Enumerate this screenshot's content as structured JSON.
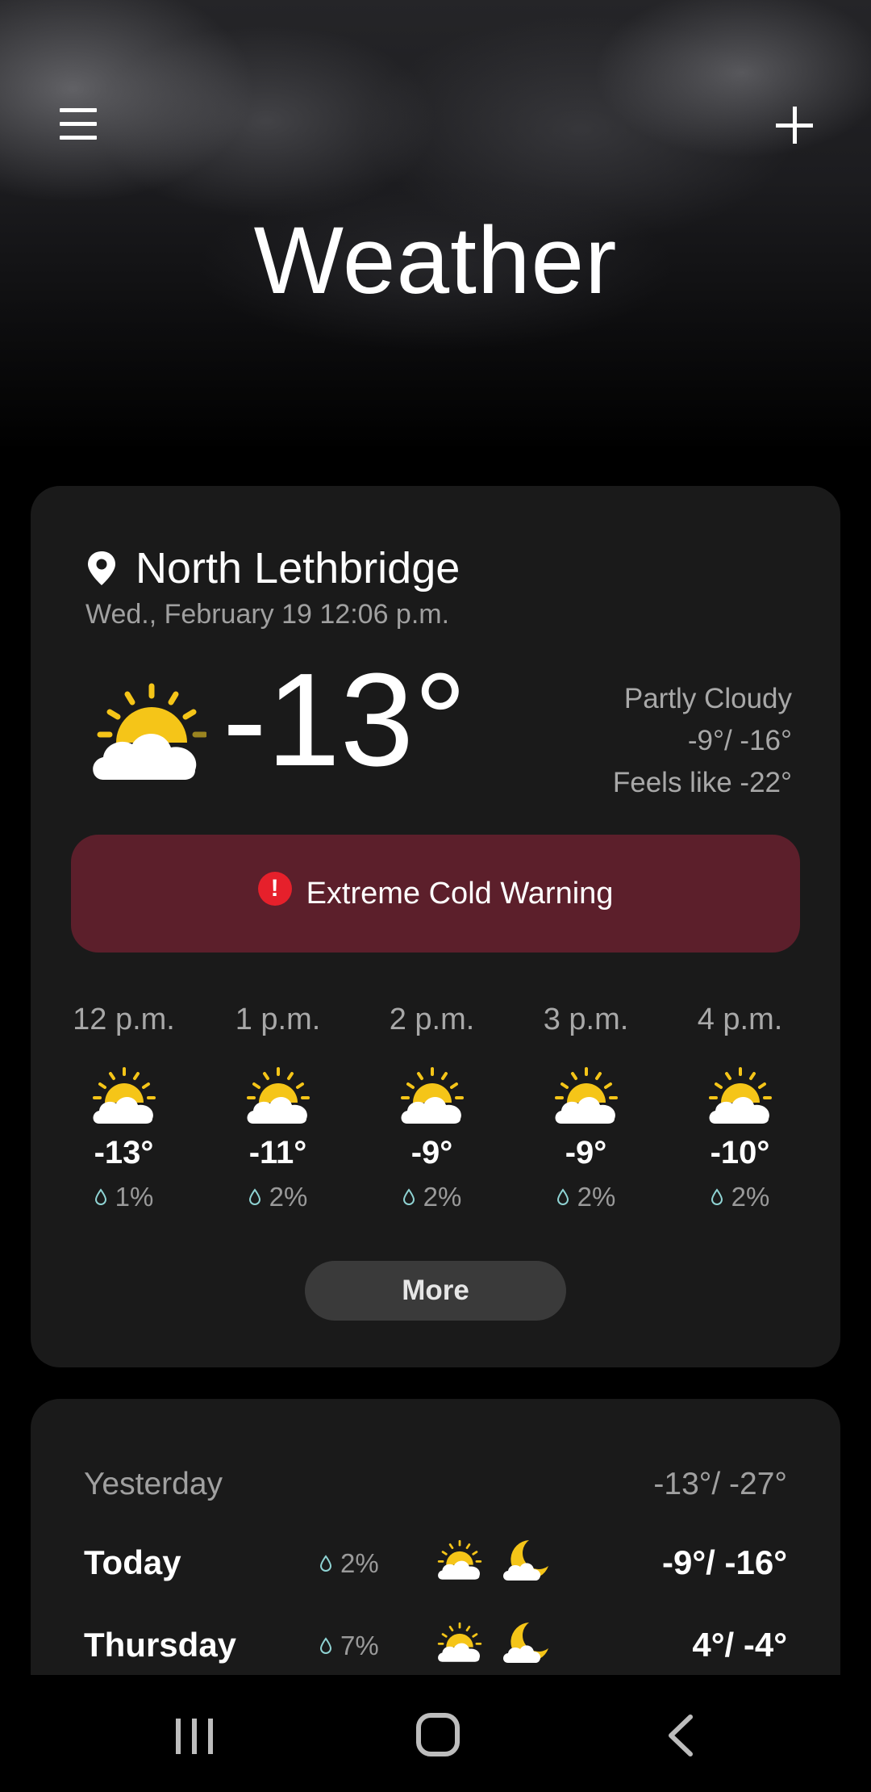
{
  "header": {
    "title": "Weather",
    "menu_icon": "hamburger-menu-icon",
    "add_icon": "plus-icon"
  },
  "current": {
    "location": "North Lethbridge",
    "datetime": "Wed., February 19 12:06 p.m.",
    "temperature": "-13°",
    "condition": "Partly Cloudy",
    "high_low": "-9°/ -16°",
    "feels_like": "Feels like -22°",
    "icon": "partly-cloudy-icon"
  },
  "alert": {
    "text": "Extreme Cold Warning",
    "icon": "exclamation-icon",
    "color": "#5c1f2b"
  },
  "hourly": [
    {
      "time": "12 p.m.",
      "temp": "-13°",
      "precip": "1%",
      "icon": "partly-cloudy-icon"
    },
    {
      "time": "1 p.m.",
      "temp": "-11°",
      "precip": "2%",
      "icon": "partly-cloudy-icon"
    },
    {
      "time": "2 p.m.",
      "temp": "-9°",
      "precip": "2%",
      "icon": "partly-cloudy-icon"
    },
    {
      "time": "3 p.m.",
      "temp": "-9°",
      "precip": "2%",
      "icon": "partly-cloudy-icon"
    },
    {
      "time": "4 p.m.",
      "temp": "-10°",
      "precip": "2%",
      "icon": "partly-cloudy-icon"
    }
  ],
  "more_label": "More",
  "daily": [
    {
      "day": "Yesterday",
      "temps": "-13°/ -27°"
    },
    {
      "day": "Today",
      "precip": "2%",
      "temps": "-9°/ -16°",
      "day_icon": "partly-cloudy-icon",
      "night_icon": "cloudy-night-icon"
    },
    {
      "day": "Thursday",
      "precip": "7%",
      "temps": "4°/ -4°",
      "day_icon": "partly-cloudy-icon",
      "night_icon": "cloudy-night-icon"
    }
  ],
  "navbar": {
    "recents_icon": "recent-apps-icon",
    "home_icon": "home-icon",
    "back_icon": "back-icon"
  },
  "colors": {
    "card": "#1a1a1a",
    "sun": "#f5c518",
    "alert": "#5c1f2b",
    "alert_icon": "#e6202b",
    "precip_drop": "#8fd3d3"
  }
}
